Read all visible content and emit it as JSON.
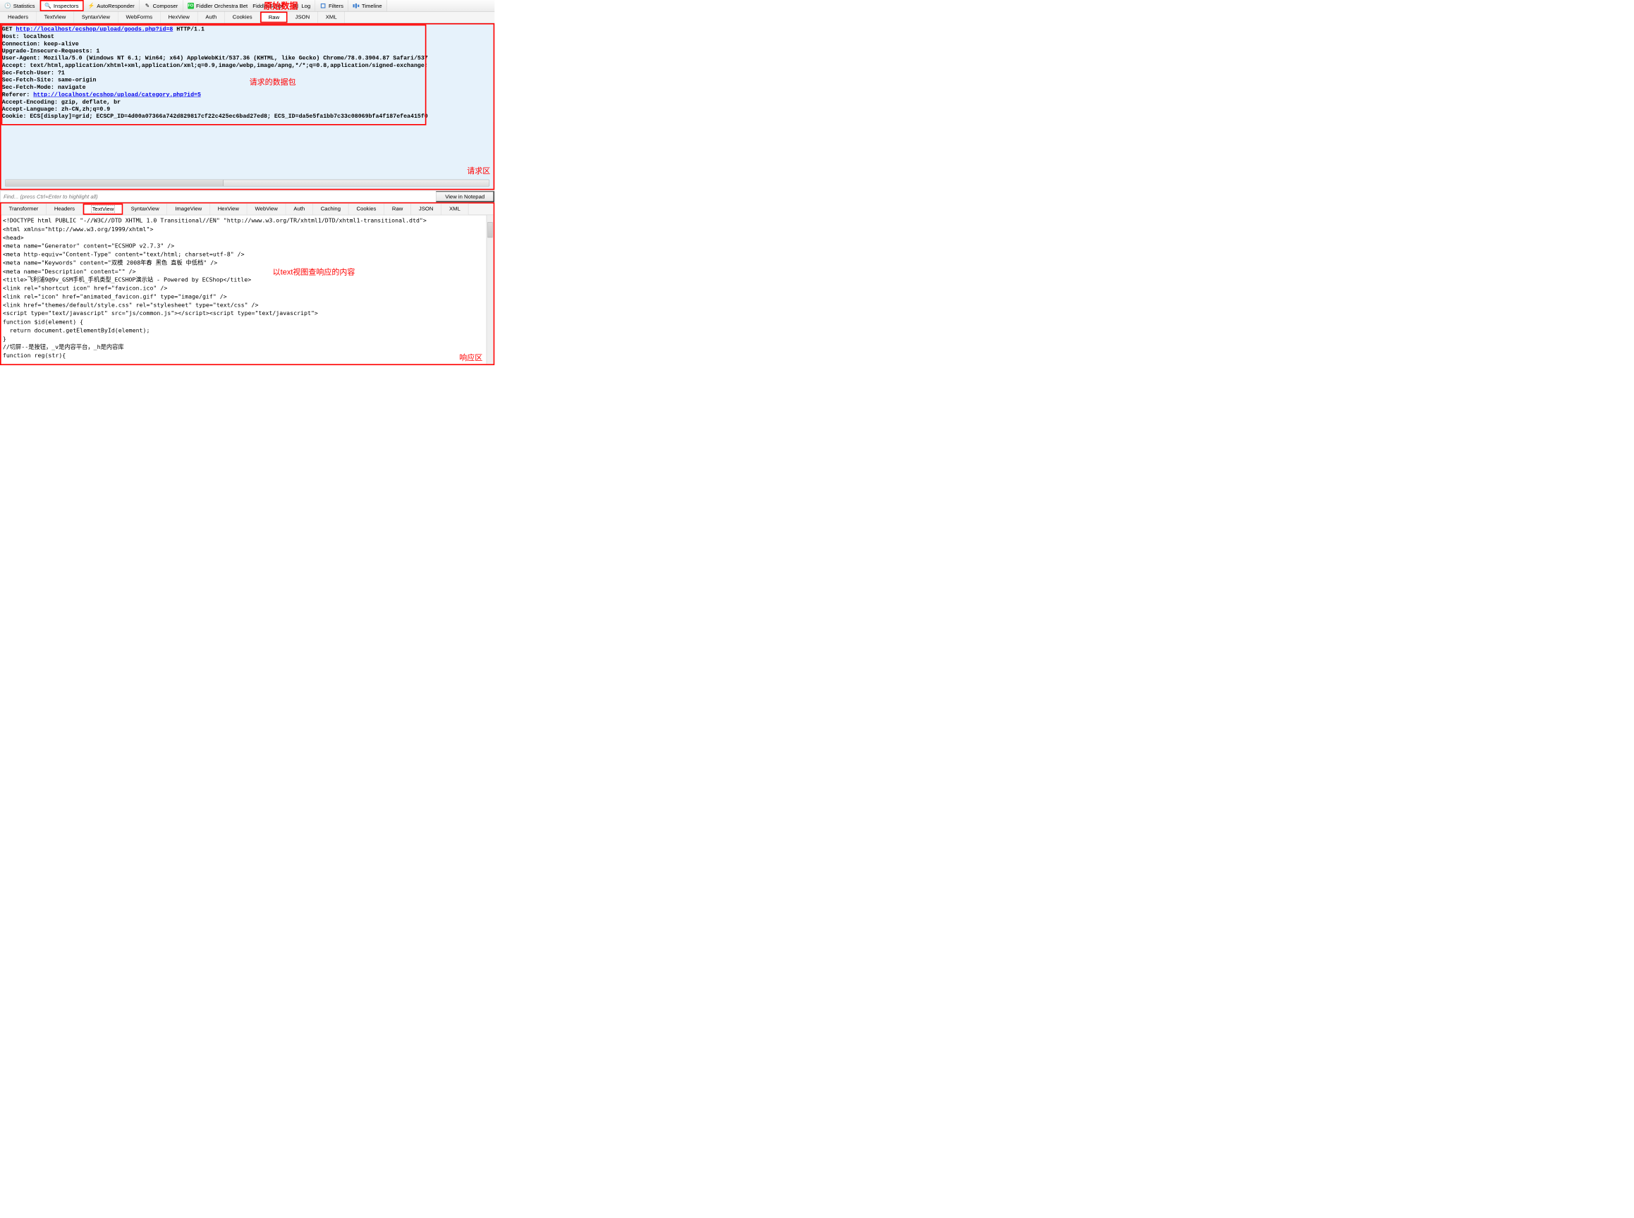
{
  "annotations": {
    "top_overlay": "原始数据",
    "request_packet": "请求的数据包",
    "request_area": "请求区",
    "response_view": "以text视图查响应的内容",
    "response_area": "响应区"
  },
  "main_tabs": [
    {
      "label": "Statistics"
    },
    {
      "label": "Inspectors",
      "selected": true
    },
    {
      "label": "AutoResponder"
    },
    {
      "label": "Composer"
    },
    {
      "label": "Fiddler Orchestra Beta"
    },
    {
      "label": "FiddlerScript"
    },
    {
      "label": "Log"
    },
    {
      "label": "Filters"
    },
    {
      "label": "Timeline"
    }
  ],
  "request_tabs": [
    {
      "label": "Headers"
    },
    {
      "label": "TextView"
    },
    {
      "label": "SyntaxView"
    },
    {
      "label": "WebForms"
    },
    {
      "label": "HexView"
    },
    {
      "label": "Auth"
    },
    {
      "label": "Cookies"
    },
    {
      "label": "Raw",
      "selected": true
    },
    {
      "label": "JSON"
    },
    {
      "label": "XML"
    }
  ],
  "response_tabs": [
    {
      "label": "Transformer"
    },
    {
      "label": "Headers"
    },
    {
      "label": "TextView",
      "selected": true
    },
    {
      "label": "SyntaxView"
    },
    {
      "label": "ImageView"
    },
    {
      "label": "HexView"
    },
    {
      "label": "WebView"
    },
    {
      "label": "Auth"
    },
    {
      "label": "Caching"
    },
    {
      "label": "Cookies"
    },
    {
      "label": "Raw"
    },
    {
      "label": "JSON"
    },
    {
      "label": "XML"
    }
  ],
  "request_raw": {
    "method": "GET",
    "url": "http://localhost/ecshop/upload/goods.php?id=8",
    "http_ver": "HTTP/1.1",
    "lines": [
      "Host: localhost",
      "Connection: keep-alive",
      "Upgrade-Insecure-Requests: 1",
      "User-Agent: Mozilla/5.0 (Windows NT 6.1; Win64; x64) AppleWebKit/537.36 (KHTML, like Gecko) Chrome/78.0.3904.87 Safari/537",
      "Accept: text/html,application/xhtml+xml,application/xml;q=0.9,image/webp,image/apng,*/*;q=0.8,application/signed-exchange;",
      "Sec-Fetch-Site: same-origin",
      "Sec-Fetch-Mode: navigate"
    ],
    "referer_label": "Referer: ",
    "referer_url": "http://localhost/ecshop/upload/category.php?id=5",
    "lines2": [
      "Sec-Fetch-User: ?1",
      "Accept-Encoding: gzip, deflate, br",
      "Accept-Language: zh-CN,zh;q=0.9",
      "Cookie: ECS[display]=grid; ECSCP_ID=4d00a07366a742d829817cf22c425ec6bad27ed8; ECS_ID=da5e5fa1bb7c33c08069bfa4f187efea415f0"
    ]
  },
  "findbar": {
    "placeholder": "Find... (press Ctrl+Enter to highlight all)",
    "button": "View in Notepad"
  },
  "response_body": "<!DOCTYPE html PUBLIC \"-//W3C//DTD XHTML 1.0 Transitional//EN\" \"http://www.w3.org/TR/xhtml1/DTD/xhtml1-transitional.dtd\">\n<html xmlns=\"http://www.w3.org/1999/xhtml\">\n<head>\n<meta name=\"Generator\" content=\"ECSHOP v2.7.3\" />\n<meta http-equiv=\"Content-Type\" content=\"text/html; charset=utf-8\" />\n<meta name=\"Keywords\" content=\"双模 2008年春 黑色 直板 中低档\" />\n<meta name=\"Description\" content=\"\" />\n<title>飞利浦9@9v_GSM手机_手机类型_ECSHOP演示站 - Powered by ECShop</title>\n<link rel=\"shortcut icon\" href=\"favicon.ico\" />\n<link rel=\"icon\" href=\"animated_favicon.gif\" type=\"image/gif\" />\n<link href=\"themes/default/style.css\" rel=\"stylesheet\" type=\"text/css\" />\n<script type=\"text/javascript\" src=\"js/common.js\"></script><script type=\"text/javascript\">\nfunction $id(element) {\n  return document.getElementById(element);\n}\n//切屏--是按钮，_v是内容平台，_h是内容库\nfunction reg(str){"
}
